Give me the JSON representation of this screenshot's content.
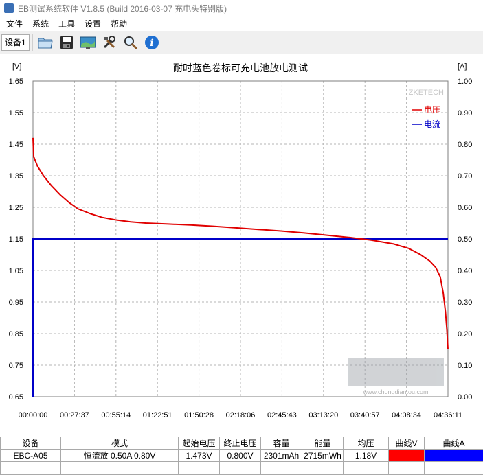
{
  "window": {
    "title": "EB测试系统软件 V1.8.5 (Build 2016-03-07 充电头特别版)"
  },
  "menu": [
    "文件",
    "系统",
    "工具",
    "设置",
    "帮助"
  ],
  "toolbar": {
    "device_tab": "设备1",
    "buttons": [
      {
        "name": "open-folder-icon"
      },
      {
        "name": "save-icon"
      },
      {
        "name": "monitor-icon"
      },
      {
        "name": "tools-icon"
      },
      {
        "name": "zoom-icon"
      },
      {
        "name": "info-icon"
      }
    ]
  },
  "chart_data": {
    "type": "line",
    "title": "耐时蓝色卷标可充电池放电测试",
    "left_unit": "[V]",
    "right_unit": "[A]",
    "watermark": "ZKETECH",
    "logo_text": "www.chongdiantou.com",
    "grid": true,
    "legend_position": "top-right",
    "y_left": {
      "range": [
        0.65,
        1.65
      ],
      "ticks": [
        "1.65",
        "1.55",
        "1.45",
        "1.35",
        "1.25",
        "1.15",
        "1.05",
        "0.95",
        "0.85",
        "0.75",
        "0.65"
      ]
    },
    "y_right": {
      "range": [
        0.0,
        1.0
      ],
      "ticks": [
        "1.00",
        "0.90",
        "0.80",
        "0.70",
        "0.60",
        "0.50",
        "0.40",
        "0.30",
        "0.20",
        "0.10",
        "0.00"
      ]
    },
    "x": {
      "range_seconds": [
        0,
        16571
      ],
      "ticks": [
        "00:00:00",
        "00:27:37",
        "00:55:14",
        "01:22:51",
        "01:50:28",
        "02:18:06",
        "02:45:43",
        "03:13:20",
        "03:40:57",
        "04:08:34",
        "04:36:11"
      ]
    },
    "series": [
      {
        "name": "电压",
        "axis": "left",
        "color": "#e00000",
        "points": [
          [
            "00:00:00",
            1.47
          ],
          [
            "00:00:30",
            1.41
          ],
          [
            "00:03:00",
            1.38
          ],
          [
            "00:07:00",
            1.35
          ],
          [
            "00:12:00",
            1.32
          ],
          [
            "00:18:00",
            1.29
          ],
          [
            "00:24:00",
            1.265
          ],
          [
            "00:30:00",
            1.245
          ],
          [
            "00:38:00",
            1.23
          ],
          [
            "00:46:00",
            1.218
          ],
          [
            "00:55:00",
            1.21
          ],
          [
            "01:05:00",
            1.204
          ],
          [
            "01:15:00",
            1.2
          ],
          [
            "01:30:00",
            1.197
          ],
          [
            "01:45:00",
            1.194
          ],
          [
            "02:00:00",
            1.19
          ],
          [
            "02:15:00",
            1.185
          ],
          [
            "02:30:00",
            1.18
          ],
          [
            "02:45:00",
            1.175
          ],
          [
            "03:00:00",
            1.169
          ],
          [
            "03:15:00",
            1.162
          ],
          [
            "03:30:00",
            1.155
          ],
          [
            "03:45:00",
            1.146
          ],
          [
            "04:00:00",
            1.134
          ],
          [
            "04:10:00",
            1.12
          ],
          [
            "04:18:00",
            1.1
          ],
          [
            "04:24:00",
            1.08
          ],
          [
            "04:28:00",
            1.06
          ],
          [
            "04:31:00",
            1.03
          ],
          [
            "04:33:00",
            0.98
          ],
          [
            "04:34:30",
            0.92
          ],
          [
            "04:35:30",
            0.86
          ],
          [
            "04:36:11",
            0.8
          ]
        ]
      },
      {
        "name": "电流",
        "axis": "right",
        "color": "#0000c8",
        "points": [
          [
            "00:00:00",
            0.0
          ],
          [
            "00:00:01",
            0.5
          ],
          [
            "04:36:11",
            0.5
          ]
        ]
      }
    ]
  },
  "stats": {
    "headers": [
      "设备",
      "模式",
      "起始电压",
      "终止电压",
      "容量",
      "能量",
      "均压",
      "曲线V",
      "曲线A"
    ],
    "row": {
      "device": "EBC-A05",
      "mode": "恒流放 0.50A 0.80V",
      "start_voltage": "1.473V",
      "end_voltage": "0.800V",
      "capacity": "2301mAh",
      "energy": "2715mWh",
      "avg_voltage": "1.18V",
      "curve_v_color": "#ff0000",
      "curve_a_color": "#0000ff"
    }
  }
}
